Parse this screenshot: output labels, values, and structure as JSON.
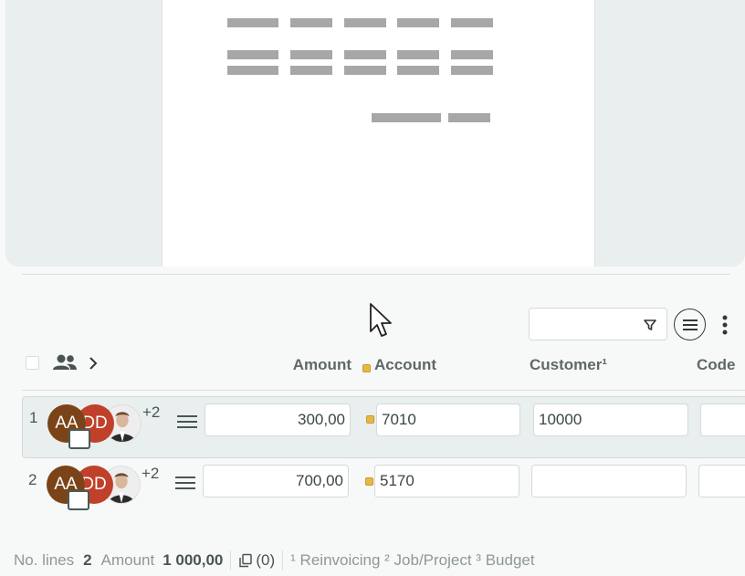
{
  "toolbar": {
    "search_value": "",
    "filter_icon": "filter-icon",
    "menu_icon": "list-menu-icon",
    "more_icon": "more-vertical-icon"
  },
  "columns": {
    "amount": "Amount",
    "account": "Account",
    "customer": "Customer¹",
    "code": "Code"
  },
  "rows": [
    {
      "num": "1",
      "avatar1": "AA",
      "avatar2": "DD",
      "extra": "+2",
      "amount": "300,00",
      "account": "7010",
      "customer": "10000",
      "code": ""
    },
    {
      "num": "2",
      "avatar1": "AA",
      "avatar2": "DD",
      "extra": "+2",
      "amount": "700,00",
      "account": "5170",
      "customer": "",
      "code": ""
    }
  ],
  "footer": {
    "lines_label": "No. lines",
    "lines_value": "2",
    "amount_label": "Amount",
    "amount_value": "1 000,00",
    "attachments": "(0)",
    "legend": "¹ Reinvoicing ² Job/Project ³ Budget"
  },
  "colors": {
    "accent_dot": "#e6b84a",
    "avatar_aa": "#7b4418",
    "avatar_dd": "#c0402a"
  }
}
